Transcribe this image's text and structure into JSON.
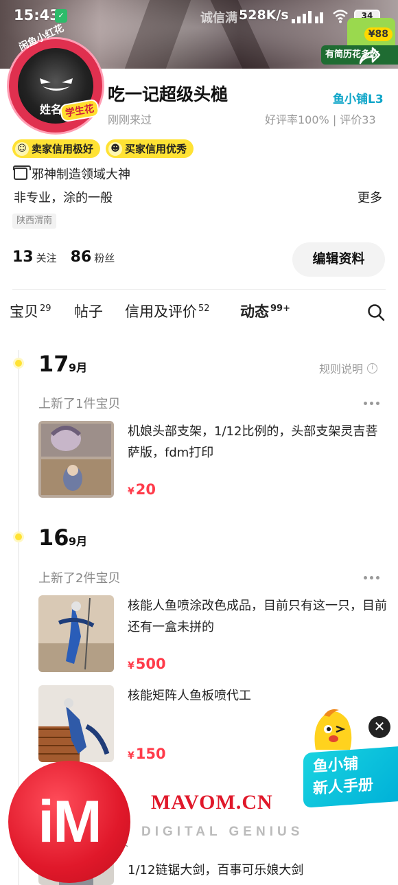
{
  "status_bar": {
    "time": "15:43",
    "shield": "✓",
    "speed": "528K/s",
    "battery": "34"
  },
  "banner": {
    "overlay_text": "诚信满",
    "promo_badge": "¥88",
    "promo_label": "有简历花多收"
  },
  "avatar": {
    "arc_text": "闲鱼小红花",
    "sub_text": "姓名",
    "badge_text": "学生花"
  },
  "profile": {
    "name": "吃一记超级头槌",
    "level": "鱼小铺L3",
    "last_seen": "刚刚来过",
    "rating": "好评率100% | 评价33",
    "credit_tags": [
      {
        "icon": "seller-credit-emoji-icon",
        "label": "卖家信用极好"
      },
      {
        "icon": "buyer-credit-emoji-icon",
        "label": "买家信用优秀"
      }
    ],
    "title": "邪神制造领域大神",
    "bio": "非专业，涂的一般",
    "more": "更多",
    "region": "陕西渭南",
    "following_count": "13",
    "following_label": "关注",
    "fans_count": "86",
    "fans_label": "粉丝",
    "edit_button": "编辑资料"
  },
  "tabs": [
    {
      "label": "宝贝",
      "count": "29",
      "active": false
    },
    {
      "label": "帖子",
      "count": "",
      "active": false
    },
    {
      "label": "信用及评价",
      "count": "52",
      "active": false
    },
    {
      "label": "动态",
      "count": "99+",
      "active": true
    }
  ],
  "timeline": {
    "rules_link": "规则说明",
    "days": [
      {
        "day": "17",
        "month": "9月",
        "header": "上新了1件宝贝",
        "items": [
          {
            "title": "机娘头部支架，1/12比例的，头部支架灵吉菩萨版，fdm打印",
            "price": "20"
          }
        ]
      },
      {
        "day": "16",
        "month": "9月",
        "header": "上新了2件宝贝",
        "items": [
          {
            "title": "核能人鱼喷涂改色成品，目前只有这一只，目前还有一盒未拼的",
            "price": "500"
          },
          {
            "title": "核能矩阵人鱼板喷代工",
            "price": "150"
          },
          {
            "title": "1/12链锯大剑，百事可乐娘大剑",
            "price": ""
          }
        ]
      }
    ],
    "partial_char": "贝"
  },
  "float_guide": {
    "close": "✕",
    "label_line1": "鱼小铺",
    "label_line2": "新人手册"
  },
  "watermark": {
    "logo": "iM",
    "site": "MAVOM.CN",
    "tagline": "DIGITAL GENIUS"
  },
  "currency": "¥",
  "colors": {
    "accent_yellow": "#ffe234",
    "price_red": "#ff3b4a",
    "level_blue": "#0ea5c8",
    "watermark_red": "#e0182a"
  }
}
